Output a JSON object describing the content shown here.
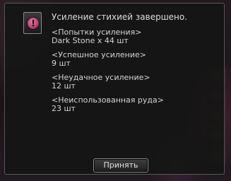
{
  "dialog": {
    "title": "Усиление стихией завершено.",
    "sections": [
      {
        "label": "<Попытки усиления>",
        "value": "Dark Stone x 44 шт"
      },
      {
        "label": "<Успешное усиление>",
        "value": "9 шт"
      },
      {
        "label": "<Неудачное усиление>",
        "value": "12 шт"
      },
      {
        "label": "<Неиспользованная руда>",
        "value": "23 шт"
      }
    ],
    "confirm_label": "Принять",
    "icon": {
      "name": "warning-icon",
      "glyph": "!"
    }
  }
}
